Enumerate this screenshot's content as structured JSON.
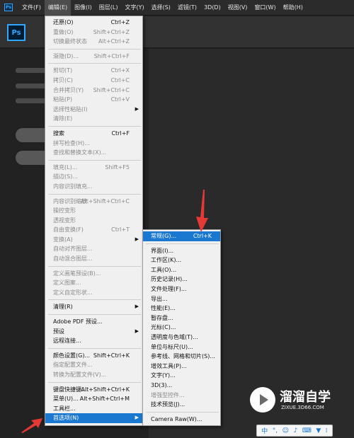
{
  "menubar": {
    "app_icon": "Ps",
    "items": [
      {
        "label": "文件(F)"
      },
      {
        "label": "编辑(E)"
      },
      {
        "label": "图像(I)"
      },
      {
        "label": "图层(L)"
      },
      {
        "label": "文字(Y)"
      },
      {
        "label": "选择(S)"
      },
      {
        "label": "滤镜(T)"
      },
      {
        "label": "3D(D)"
      },
      {
        "label": "视图(V)"
      },
      {
        "label": "窗口(W)"
      },
      {
        "label": "帮助(H)"
      }
    ]
  },
  "toolbar": {
    "logo": "Ps"
  },
  "edit_menu": {
    "items": [
      {
        "label": "还原(O)",
        "shortcut": "Ctrl+Z"
      },
      {
        "label": "重做(O)",
        "shortcut": "Shift+Ctrl+Z"
      },
      {
        "label": "切换最终状态",
        "shortcut": "Alt+Ctrl+Z"
      },
      {
        "label": "渐隐(D)...",
        "shortcut": "Shift+Ctrl+F"
      },
      {
        "label": "剪切(T)",
        "shortcut": "Ctrl+X"
      },
      {
        "label": "拷贝(C)",
        "shortcut": "Ctrl+C"
      },
      {
        "label": "合并拷贝(Y)",
        "shortcut": "Shift+Ctrl+C"
      },
      {
        "label": "粘贴(P)",
        "shortcut": "Ctrl+V"
      },
      {
        "label": "选择性粘贴(I)",
        "shortcut": ""
      },
      {
        "label": "清除(E)",
        "shortcut": ""
      },
      {
        "label": "搜索",
        "shortcut": "Ctrl+F"
      },
      {
        "label": "拼写检查(H)...",
        "shortcut": ""
      },
      {
        "label": "查找和替换文本(X)...",
        "shortcut": ""
      },
      {
        "label": "填充(L)...",
        "shortcut": "Shift+F5"
      },
      {
        "label": "描边(S)...",
        "shortcut": ""
      },
      {
        "label": "内容识别填充...",
        "shortcut": ""
      },
      {
        "label": "内容识别缩放",
        "shortcut": "Alt+Shift+Ctrl+C"
      },
      {
        "label": "操控变形",
        "shortcut": ""
      },
      {
        "label": "透视变形",
        "shortcut": ""
      },
      {
        "label": "自由变换(F)",
        "shortcut": "Ctrl+T"
      },
      {
        "label": "变换(A)",
        "shortcut": ""
      },
      {
        "label": "自动对齐图层...",
        "shortcut": ""
      },
      {
        "label": "自动混合图层...",
        "shortcut": ""
      },
      {
        "label": "定义画笔预设(B)...",
        "shortcut": ""
      },
      {
        "label": "定义图案...",
        "shortcut": ""
      },
      {
        "label": "定义自定形状...",
        "shortcut": ""
      },
      {
        "label": "清理(R)",
        "shortcut": ""
      },
      {
        "label": "Adobe PDF 预设...",
        "shortcut": ""
      },
      {
        "label": "预设",
        "shortcut": ""
      },
      {
        "label": "远程连接...",
        "shortcut": ""
      },
      {
        "label": "颜色设置(G)...",
        "shortcut": "Shift+Ctrl+K"
      },
      {
        "label": "指定配置文件...",
        "shortcut": ""
      },
      {
        "label": "转换为配置文件(V)...",
        "shortcut": ""
      },
      {
        "label": "键盘快捷键...",
        "shortcut": "Alt+Shift+Ctrl+K"
      },
      {
        "label": "菜单(U)...",
        "shortcut": "Alt+Shift+Ctrl+M"
      },
      {
        "label": "工具栏...",
        "shortcut": ""
      },
      {
        "label": "首选项(N)",
        "shortcut": ""
      }
    ]
  },
  "prefs_menu": {
    "items": [
      {
        "label": "常规(G)...",
        "shortcut": "Ctrl+K"
      },
      {
        "label": "界面(I)...",
        "shortcut": ""
      },
      {
        "label": "工作区(K)...",
        "shortcut": ""
      },
      {
        "label": "工具(O)...",
        "shortcut": ""
      },
      {
        "label": "历史记录(H)...",
        "shortcut": ""
      },
      {
        "label": "文件处理(F)...",
        "shortcut": ""
      },
      {
        "label": "导出...",
        "shortcut": ""
      },
      {
        "label": "性能(E)...",
        "shortcut": ""
      },
      {
        "label": "暂存盘...",
        "shortcut": ""
      },
      {
        "label": "光标(C)...",
        "shortcut": ""
      },
      {
        "label": "透明度与色域(T)...",
        "shortcut": ""
      },
      {
        "label": "单位与标尺(U)...",
        "shortcut": ""
      },
      {
        "label": "参考线、网格和切片(S)...",
        "shortcut": ""
      },
      {
        "label": "增效工具(P)...",
        "shortcut": ""
      },
      {
        "label": "文字(Y)...",
        "shortcut": ""
      },
      {
        "label": "3D(3)...",
        "shortcut": ""
      },
      {
        "label": "增强型控件...",
        "shortcut": ""
      },
      {
        "label": "技术预览(J)...",
        "shortcut": ""
      },
      {
        "label": "Camera Raw(W)...",
        "shortcut": ""
      }
    ]
  },
  "watermark": {
    "title": "溜溜自学",
    "url": "ZIXUE.3D66.COM"
  },
  "ime": {
    "lang": "中"
  },
  "colors": {
    "highlight": "#1b78d0",
    "annotation_arrow": "#e53935",
    "menu_bg": "#f0f0f0"
  }
}
